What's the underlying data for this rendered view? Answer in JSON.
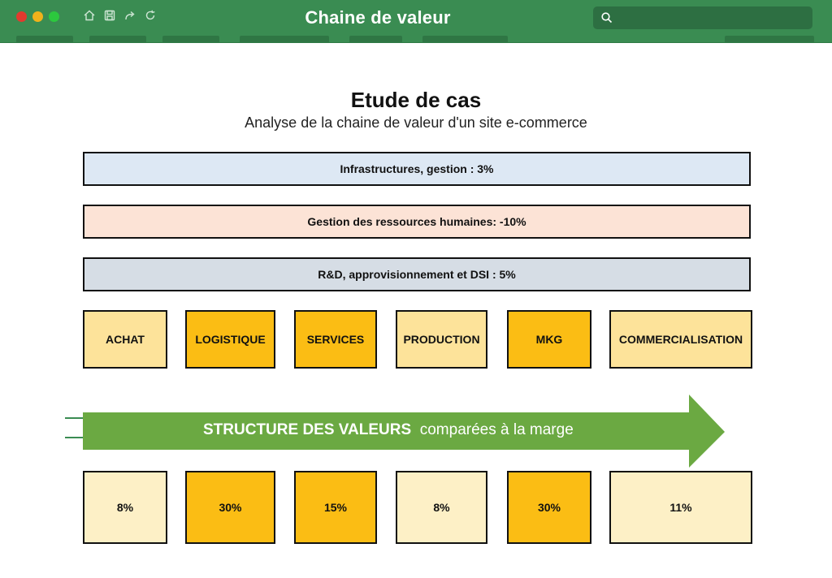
{
  "window": {
    "title": "Chaine de valeur",
    "icons": [
      "home-icon",
      "save-icon",
      "share-icon",
      "refresh-icon",
      "search-icon"
    ],
    "accent": "#3a8c52"
  },
  "diagram": {
    "title": "Etude de cas",
    "subtitle": "Analyse de la chaine de valeur d'un site e-commerce",
    "support_activities": [
      {
        "label": "Infrastructures, gestion : 3%",
        "color": "#dde8f4"
      },
      {
        "label": "Gestion des ressources humaines: -10%",
        "color": "#fce3d6"
      },
      {
        "label": "R&D, approvisionnement et DSI : 5%",
        "color": "#d6dde5"
      }
    ],
    "primary_activities": [
      {
        "label": "ACHAT",
        "color": "#fde39a"
      },
      {
        "label": "LOGISTIQUE",
        "color": "#fbbd14"
      },
      {
        "label": "SERVICES",
        "color": "#fbbd14"
      },
      {
        "label": "PRODUCTION",
        "color": "#fde39a"
      },
      {
        "label": "MKG",
        "color": "#fbbd14"
      },
      {
        "label": "COMMERCIALISATION",
        "color": "#fde39a"
      }
    ],
    "arrow": {
      "bold_text": "STRUCTURE DES VALEURS",
      "text": "comparées à la marge",
      "color": "#6ba942"
    },
    "values": [
      {
        "label": "8%",
        "color": "#fdf0c6"
      },
      {
        "label": "30%",
        "color": "#fbbd14"
      },
      {
        "label": "15%",
        "color": "#fbbd14"
      },
      {
        "label": "8%",
        "color": "#fdf0c6"
      },
      {
        "label": "30%",
        "color": "#fbbd14"
      },
      {
        "label": "11%",
        "color": "#fdf0c6"
      }
    ]
  }
}
